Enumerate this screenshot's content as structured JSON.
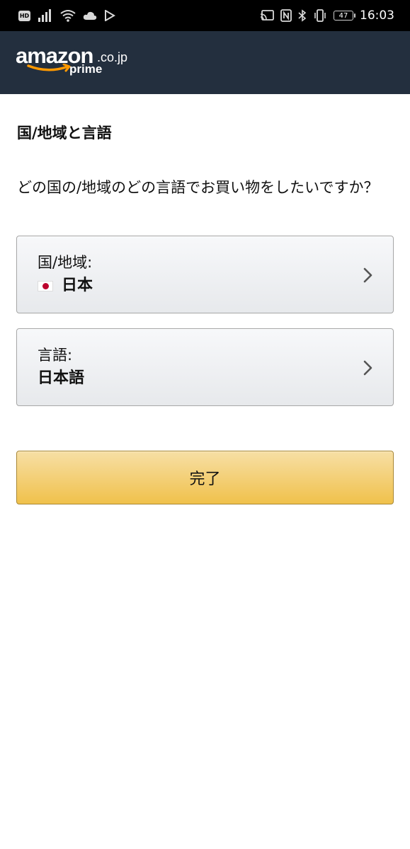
{
  "status_bar": {
    "hd_label": "HD",
    "battery_level": "47",
    "time": "16:03",
    "icons": [
      "signal-icon",
      "wifi-icon",
      "cloud-icon",
      "play-store-icon",
      "cast-icon",
      "nfc-icon",
      "bluetooth-icon",
      "vibrate-icon"
    ]
  },
  "header": {
    "logo_word": "amazon",
    "logo_tld": ".co.jp",
    "logo_sub": "prime",
    "background": "#232f3e"
  },
  "main": {
    "title": "国/地域と言語",
    "question": "どの国の/地域のどの言語でお買い物をしたいですか？",
    "country": {
      "label": "国/地域:",
      "value": "日本",
      "flag_icon": "japan-flag-icon"
    },
    "language": {
      "label": "言語:",
      "value": "日本語"
    },
    "done_label": "完了",
    "done_color": "#f0c14b"
  }
}
